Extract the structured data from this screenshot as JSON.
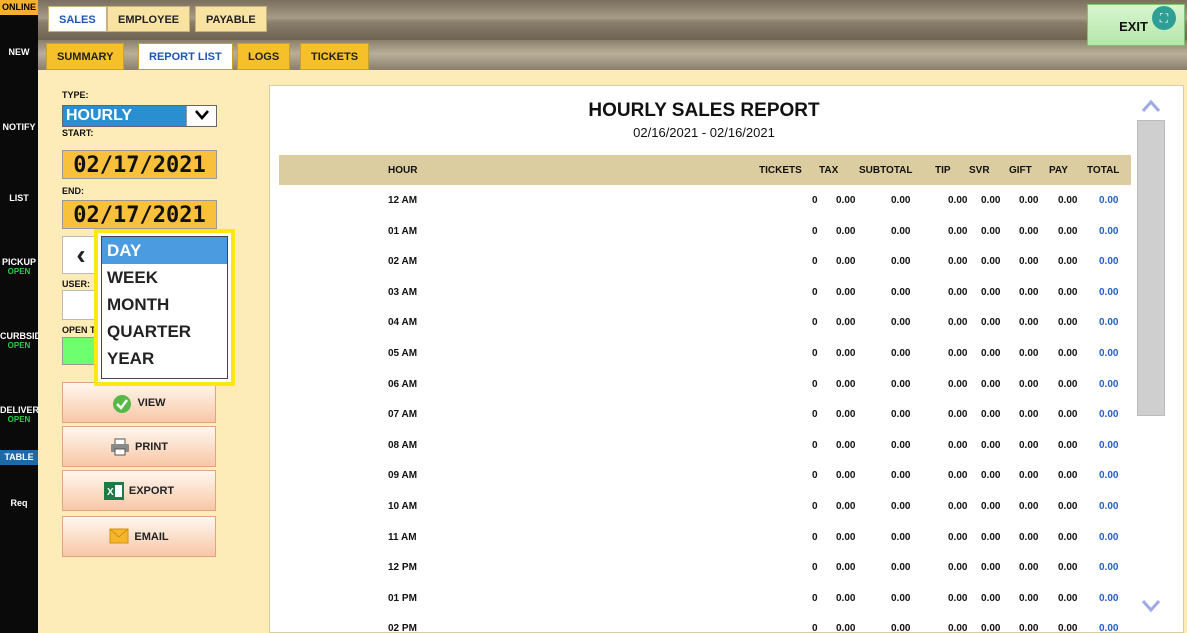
{
  "sidebar": {
    "online": "ONLINE",
    "items": [
      {
        "label": "NEW",
        "sub": ""
      },
      {
        "label": "NOTIFY",
        "sub": ""
      },
      {
        "label": "LIST",
        "sub": ""
      },
      {
        "label": "PICKUP",
        "sub": "OPEN"
      },
      {
        "label": "CURBSID",
        "sub": "OPEN"
      },
      {
        "label": "DELIVER",
        "sub": "OPEN"
      },
      {
        "label": "TABLE",
        "sub": ""
      },
      {
        "label": "Req",
        "sub": ""
      }
    ]
  },
  "top_tabs": [
    "SALES",
    "EMPLOYEE",
    "PAYABLE"
  ],
  "sub_tabs": [
    "SUMMARY",
    "REPORT LIST",
    "LOGS",
    "TICKETS"
  ],
  "exit_label": "EXIT",
  "filters": {
    "type_label": "TYPE:",
    "type_value": "HOURLY",
    "start_label": "START:",
    "start_value": "02/17/2021",
    "end_label": "END:",
    "end_value": "02/17/2021",
    "user_label": "USER:",
    "open_label": "OPEN T"
  },
  "actions": {
    "view": "VIEW",
    "print": "PRINT",
    "export": "EXPORT",
    "email": "EMAIL"
  },
  "dropdown": {
    "selected": "DAY",
    "options": [
      "DAY",
      "WEEK",
      "MONTH",
      "QUARTER",
      "YEAR"
    ]
  },
  "report": {
    "title": "HOURLY SALES REPORT",
    "date_range": "02/16/2021 - 02/16/2021",
    "columns": [
      "HOUR",
      "TICKETS",
      "TAX",
      "SUBTOTAL",
      "TIP",
      "SVR",
      "GIFT",
      "PAY",
      "TOTAL"
    ],
    "rows": [
      [
        "12 AM",
        "0",
        "0.00",
        "0.00",
        "0.00",
        "0.00",
        "0.00",
        "0.00",
        "0.00"
      ],
      [
        "01 AM",
        "0",
        "0.00",
        "0.00",
        "0.00",
        "0.00",
        "0.00",
        "0.00",
        "0.00"
      ],
      [
        "02 AM",
        "0",
        "0.00",
        "0.00",
        "0.00",
        "0.00",
        "0.00",
        "0.00",
        "0.00"
      ],
      [
        "03 AM",
        "0",
        "0.00",
        "0.00",
        "0.00",
        "0.00",
        "0.00",
        "0.00",
        "0.00"
      ],
      [
        "04 AM",
        "0",
        "0.00",
        "0.00",
        "0.00",
        "0.00",
        "0.00",
        "0.00",
        "0.00"
      ],
      [
        "05 AM",
        "0",
        "0.00",
        "0.00",
        "0.00",
        "0.00",
        "0.00",
        "0.00",
        "0.00"
      ],
      [
        "06 AM",
        "0",
        "0.00",
        "0.00",
        "0.00",
        "0.00",
        "0.00",
        "0.00",
        "0.00"
      ],
      [
        "07 AM",
        "0",
        "0.00",
        "0.00",
        "0.00",
        "0.00",
        "0.00",
        "0.00",
        "0.00"
      ],
      [
        "08 AM",
        "0",
        "0.00",
        "0.00",
        "0.00",
        "0.00",
        "0.00",
        "0.00",
        "0.00"
      ],
      [
        "09 AM",
        "0",
        "0.00",
        "0.00",
        "0.00",
        "0.00",
        "0.00",
        "0.00",
        "0.00"
      ],
      [
        "10 AM",
        "0",
        "0.00",
        "0.00",
        "0.00",
        "0.00",
        "0.00",
        "0.00",
        "0.00"
      ],
      [
        "11 AM",
        "0",
        "0.00",
        "0.00",
        "0.00",
        "0.00",
        "0.00",
        "0.00",
        "0.00"
      ],
      [
        "12 PM",
        "0",
        "0.00",
        "0.00",
        "0.00",
        "0.00",
        "0.00",
        "0.00",
        "0.00"
      ],
      [
        "01 PM",
        "0",
        "0.00",
        "0.00",
        "0.00",
        "0.00",
        "0.00",
        "0.00",
        "0.00"
      ],
      [
        "02 PM",
        "0",
        "0.00",
        "0.00",
        "0.00",
        "0.00",
        "0.00",
        "0.00",
        "0.00"
      ]
    ]
  },
  "colors": {
    "total_value": "#1f5fc7",
    "selected_option": "#4a9be0",
    "dropdown_highlight": "#ffe80f",
    "date_box": "#f9c13b"
  }
}
